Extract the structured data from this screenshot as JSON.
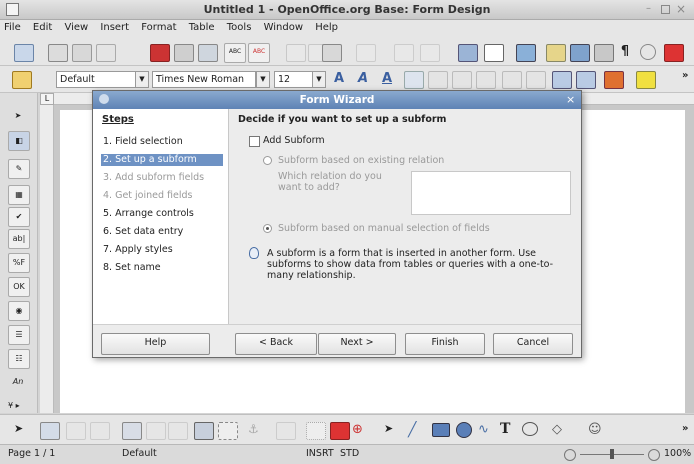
{
  "window": {
    "title": "Untitled 1 - OpenOffice.org Base: Form Design"
  },
  "menu": [
    "File",
    "Edit",
    "View",
    "Insert",
    "Format",
    "Table",
    "Tools",
    "Window",
    "Help"
  ],
  "formatting": {
    "style": "Default",
    "font": "Times New Roman",
    "size": "12"
  },
  "dialog": {
    "title": "Form Wizard",
    "steps_header": "Steps",
    "steps": [
      {
        "label": "1. Field selection",
        "state": "normal"
      },
      {
        "label": "2. Set up a subform",
        "state": "selected"
      },
      {
        "label": "3. Add subform fields",
        "state": "disabled"
      },
      {
        "label": "4. Get joined fields",
        "state": "disabled"
      },
      {
        "label": "5. Arrange controls",
        "state": "normal"
      },
      {
        "label": "6. Set data entry",
        "state": "normal"
      },
      {
        "label": "7. Apply styles",
        "state": "normal"
      },
      {
        "label": "8. Set name",
        "state": "normal"
      }
    ],
    "heading": "Decide if you want to set up a subform",
    "add_subform_label": "Add Subform",
    "add_subform_checked": false,
    "option_existing": "Subform based on existing relation",
    "relation_prompt": "Which relation do you want to add?",
    "option_manual": "Subform based on manual selection of fields",
    "info_text": "A subform is a form that is inserted in another form. Use subforms to show data from tables or queries with a one-to-many relationship.",
    "buttons": {
      "help": "Help",
      "back": "< Back",
      "next": "Next >",
      "finish": "Finish",
      "cancel": "Cancel"
    }
  },
  "left_toolbar": {
    "label_an": "An"
  },
  "status": {
    "page": "Page 1 / 1",
    "style": "Default",
    "insert_mode": "INSRT",
    "selection_mode": "STD",
    "zoom": "100%"
  }
}
